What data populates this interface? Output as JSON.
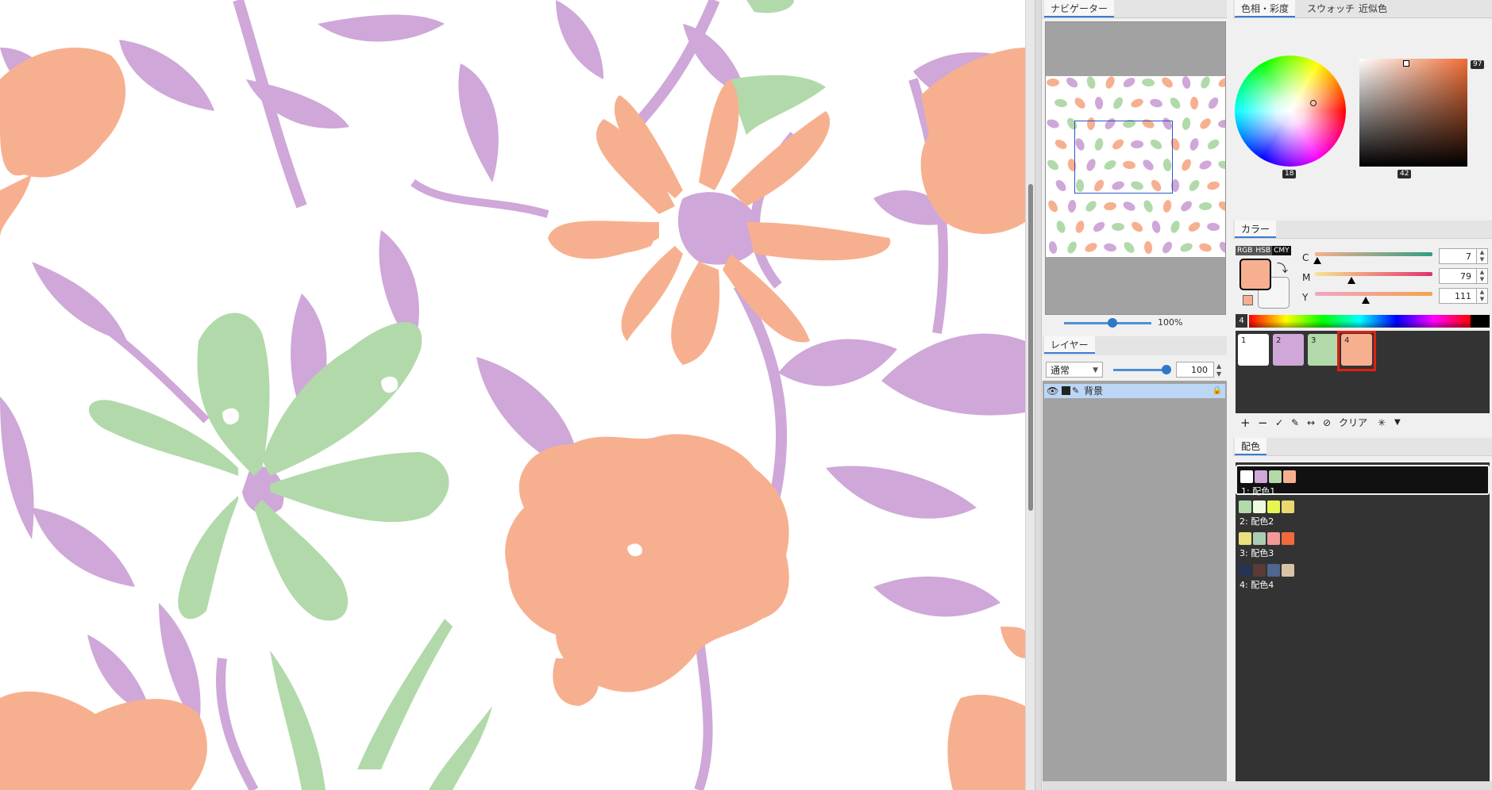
{
  "navigator": {
    "tab_label": "ナビゲーター",
    "zoom_label": "100%"
  },
  "layers": {
    "tab_label": "レイヤー",
    "blend_mode": "通常",
    "opacity": "100",
    "layer_name": "背景"
  },
  "color": {
    "tabs": [
      "色相・彩度",
      "スウォッチ",
      "近似色"
    ],
    "hue_value": "18",
    "saturation_value": "42",
    "brightness_value": "97",
    "section_label": "カラー",
    "modes": [
      "RGB",
      "HSB",
      "CMY"
    ],
    "active_mode": "CMY",
    "current_color": "#f7b08f",
    "sliders": [
      {
        "label": "C",
        "value": "7",
        "position": 0.02
      },
      {
        "label": "M",
        "value": "79",
        "position": 0.31
      },
      {
        "label": "Y",
        "value": "111",
        "position": 0.43
      }
    ],
    "palette_number": "4",
    "swatches": [
      {
        "num": "1",
        "color": "#ffffff"
      },
      {
        "num": "2",
        "color": "#cfa7d8"
      },
      {
        "num": "3",
        "color": "#b2d9aa"
      },
      {
        "num": "4",
        "color": "#f7b08f"
      }
    ],
    "selected_swatch": "4",
    "swatch_tools_clear": "クリア"
  },
  "haishoku": {
    "tab_label": "配色",
    "sets": [
      {
        "label": "1: 配色1",
        "colors": [
          "#ffffff",
          "#cfa7d8",
          "#b2d9aa",
          "#f7b08f"
        ],
        "active": true
      },
      {
        "label": "2: 配色2",
        "colors": [
          "#b2d9aa",
          "#eefadc",
          "#e6f550",
          "#ecd870"
        ],
        "active": false
      },
      {
        "label": "3: 配色3",
        "colors": [
          "#ecdf7f",
          "#a9cdb4",
          "#f29a9a",
          "#ef6a3e"
        ],
        "active": false
      },
      {
        "label": "4: 配色4",
        "colors": [
          "#263454",
          "#5b3b35",
          "#4f6690",
          "#d9c3a7"
        ],
        "active": false
      }
    ]
  },
  "pattern_colors": {
    "orange": "#f7b08f",
    "purple": "#cfa7d8",
    "green": "#b2d9aa"
  }
}
